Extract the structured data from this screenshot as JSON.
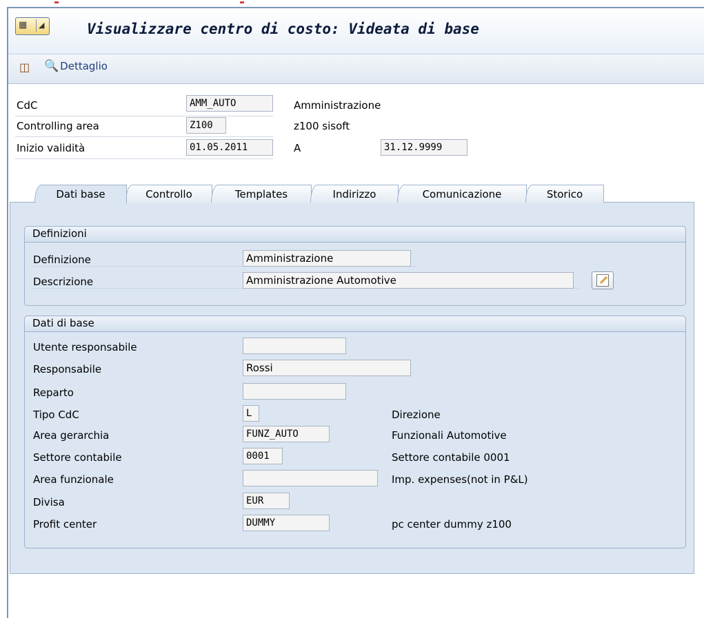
{
  "title": "Visualizzare centro di costo: Videata di base",
  "toolbar": {
    "detail_label": "Dettaglio"
  },
  "header": {
    "cdc_label": "CdC",
    "cdc_value": "AMM_AUTO",
    "cdc_text": "Amministrazione",
    "area_label": "Controlling area",
    "area_value": "Z100",
    "area_text": "z100 sisoft",
    "valid_label": "Inizio validità",
    "valid_from": "01.05.2011",
    "to_label": "A",
    "valid_to": "31.12.9999"
  },
  "tabs": [
    {
      "label": "Dati base",
      "active": true
    },
    {
      "label": "Controllo"
    },
    {
      "label": "Templates"
    },
    {
      "label": "Indirizzo"
    },
    {
      "label": "Comunicazione"
    },
    {
      "label": "Storico"
    }
  ],
  "definizioni": {
    "title": "Definizioni",
    "definizione_label": "Definizione",
    "definizione_value": "Amministrazione",
    "descrizione_label": "Descrizione",
    "descrizione_value": "Amministrazione Automotive"
  },
  "dati_di_base": {
    "title": "Dati di base",
    "rows": [
      {
        "label": "Utente responsabile",
        "value": "",
        "text": ""
      },
      {
        "label": "Responsabile",
        "value": "Rossi",
        "text": ""
      },
      {
        "label": "Reparto",
        "value": "",
        "text": ""
      },
      {
        "label": "Tipo CdC",
        "value": "L",
        "text": "Direzione"
      },
      {
        "label": "Area gerarchia",
        "value": "FUNZ_AUTO",
        "text": "Funzionali Automotive"
      },
      {
        "label": "Settore contabile",
        "value": "0001",
        "text": "Settore contabile 0001"
      },
      {
        "label": "Area funzionale",
        "value": "",
        "text": "Imp. expenses(not in P&L)"
      },
      {
        "label": "Divisa",
        "value": "EUR",
        "text": ""
      },
      {
        "label": "Profit center",
        "value": "DUMMY",
        "text": "pc center dummy z100"
      }
    ]
  },
  "colors": {
    "panel": "#dbe6f2",
    "border": "#9eb2cc",
    "title": "#0b1a3c"
  }
}
